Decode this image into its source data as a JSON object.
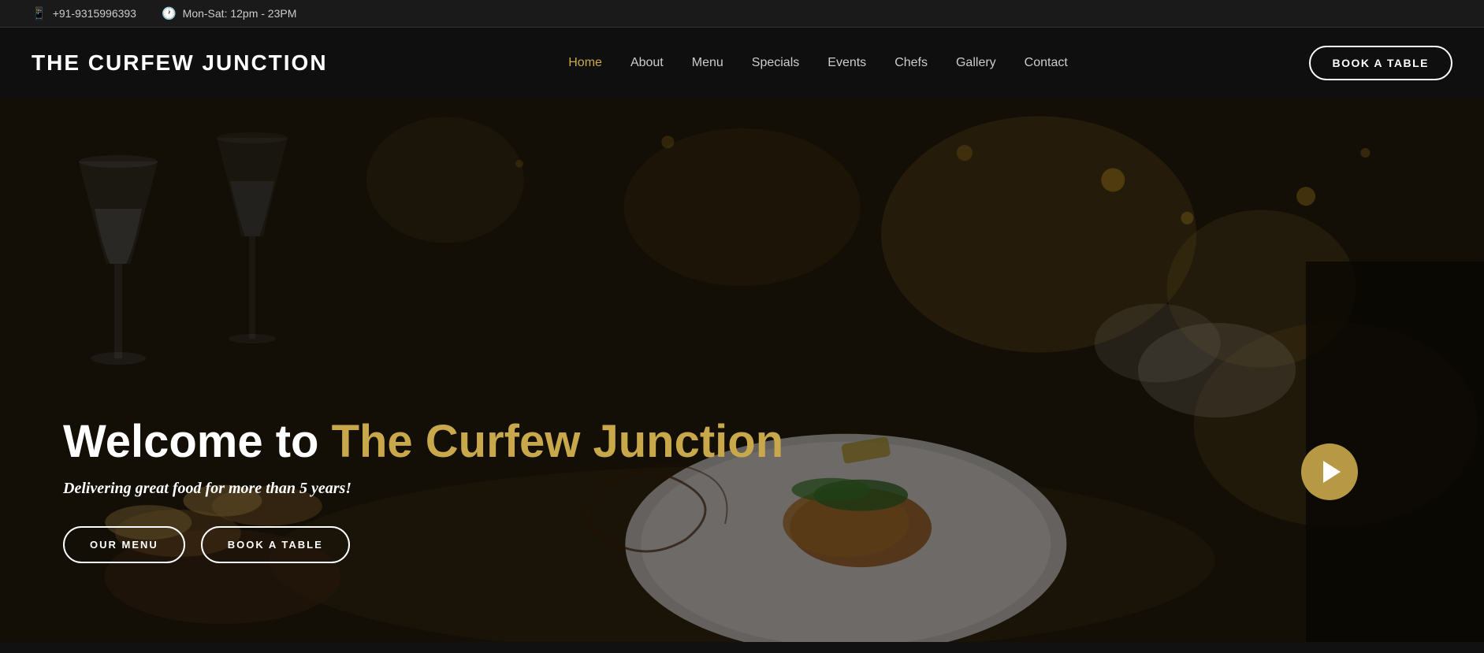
{
  "topbar": {
    "phone": "+91-9315996393",
    "hours": "Mon-Sat: 12pm - 23PM"
  },
  "navbar": {
    "logo": "THE CURFEW JUNCTION",
    "links": [
      {
        "label": "Home",
        "active": true
      },
      {
        "label": "About",
        "active": false
      },
      {
        "label": "Menu",
        "active": false
      },
      {
        "label": "Specials",
        "active": false
      },
      {
        "label": "Events",
        "active": false
      },
      {
        "label": "Chefs",
        "active": false
      },
      {
        "label": "Gallery",
        "active": false
      },
      {
        "label": "Contact",
        "active": false
      }
    ],
    "book_label": "BOOK A TABLE"
  },
  "hero": {
    "title_prefix": "Welcome to ",
    "title_accent": "The Curfew Junction",
    "subtitle": "Delivering great food for more than 5 years!",
    "btn_menu": "OUR MENU",
    "btn_book": "BOOK A TABLE"
  },
  "colors": {
    "accent": "#c9a84c",
    "dark": "#111111",
    "nav_bg": "#0f0f0f"
  }
}
